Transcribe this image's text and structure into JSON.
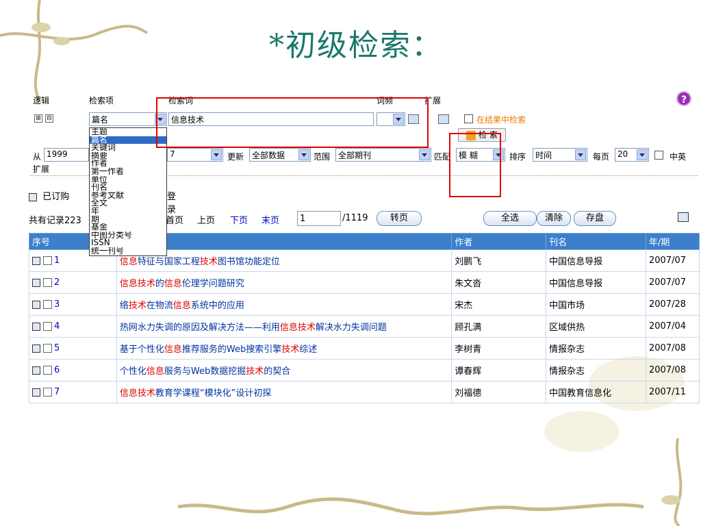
{
  "slide": {
    "title": "*初级检索："
  },
  "form": {
    "col_logic": "逻辑",
    "col_field": "检索项",
    "col_term": "检索词",
    "col_freq": "词频",
    "col_expand": "扩展",
    "logic_add": "⊞",
    "logic_remove": "⊟",
    "field_value": "篇名",
    "term_value": "信息技术",
    "within_results": "在结果中检索",
    "search_button": "检 索",
    "from_label": "从",
    "from_year": "1999",
    "to_year_partial": "7",
    "update_label": "更新",
    "update_value": "全部数据",
    "range_label": "范围",
    "range_value": "全部期刊",
    "match_label": "匹配",
    "match_value": "模 糊",
    "sort_label": "排序",
    "sort_value": "时间",
    "perpage_label": "每页",
    "perpage_value": "20",
    "lang_label": "中英",
    "expand_label": "扩展",
    "help": "?"
  },
  "field_options": [
    "主题",
    "篇名",
    "关键词",
    "摘要",
    "作者",
    "第一作者",
    "单位",
    "刊名",
    "参考文献",
    "全文",
    "年",
    "期",
    "基金",
    "中图分类号",
    "ISSN",
    "统一刊号"
  ],
  "field_selected_index": 1,
  "toolbar": {
    "subscribed": "已订购",
    "login": "登录",
    "total_prefix": "共有记录223",
    "first": "首页",
    "prev": "上页",
    "next": "下页",
    "last": "末页",
    "page_input": "1",
    "page_total": "/1119",
    "goto": "转页",
    "select_all": "全选",
    "clear": "清除",
    "save": "存盘"
  },
  "table": {
    "headers": [
      "序号",
      "",
      "作者",
      "刊名",
      "年/期"
    ],
    "rows": [
      {
        "no": "1",
        "title_parts": [
          [
            "",
            ""
          ],
          [
            "信息",
            "hl"
          ],
          [
            "特征与国家工程",
            ""
          ],
          [
            "技术",
            "hl"
          ],
          [
            "图书馆功能定位",
            ""
          ]
        ],
        "author": "刘鹏飞",
        "journal": "中国信息导报",
        "issue": "2007/07"
      },
      {
        "no": "2",
        "title_parts": [
          [
            "信息",
            "hl"
          ],
          [
            "技术",
            "hl"
          ],
          [
            "的",
            ""
          ],
          [
            "信息",
            "hl"
          ],
          [
            "伦理学问题研究",
            ""
          ]
        ],
        "author": "朱文沓",
        "journal": "中国信息导报",
        "issue": "2007/07"
      },
      {
        "no": "3",
        "title_parts": [
          [
            "络",
            ""
          ],
          [
            "技术",
            "hl"
          ],
          [
            "在物流",
            ""
          ],
          [
            "信息",
            "hl"
          ],
          [
            "系统中的应用",
            ""
          ]
        ],
        "author": "宋杰",
        "journal": "中国市场",
        "issue": "2007/28"
      },
      {
        "no": "4",
        "title_parts": [
          [
            "热网水力失调的原因及解决方法——利用",
            ""
          ],
          [
            "信息",
            "hl"
          ],
          [
            "技术",
            "hl"
          ],
          [
            "解决水力失调问题",
            ""
          ]
        ],
        "author": "顾孔满",
        "journal": "区域供热",
        "issue": "2007/04"
      },
      {
        "no": "5",
        "title_parts": [
          [
            "基于个性化",
            ""
          ],
          [
            "信息",
            "hl"
          ],
          [
            "推荐服务的Web搜索引擎",
            ""
          ],
          [
            "技术",
            "hl"
          ],
          [
            "综述",
            ""
          ]
        ],
        "author": "李树青",
        "journal": "情报杂志",
        "issue": "2007/08"
      },
      {
        "no": "6",
        "title_parts": [
          [
            "个性化",
            ""
          ],
          [
            "信息",
            "hl"
          ],
          [
            "服务与Web数据挖掘",
            ""
          ],
          [
            "技术",
            "hl"
          ],
          [
            "的契合",
            ""
          ]
        ],
        "author": "谭春辉",
        "journal": "情报杂志",
        "issue": "2007/08"
      },
      {
        "no": "7",
        "title_parts": [
          [
            "信息",
            "hl"
          ],
          [
            "技术",
            "hl"
          ],
          [
            "教育学课程“模块化”设计初探",
            ""
          ]
        ],
        "author": "刘福德",
        "journal": "中国教育信息化",
        "issue": "2007/11"
      }
    ]
  },
  "colors": {
    "title": "#1a7a6a",
    "header_bg": "#3d7fcb",
    "highlight": "#e00000",
    "link": "#0033a0",
    "annotation": "#e00000"
  }
}
